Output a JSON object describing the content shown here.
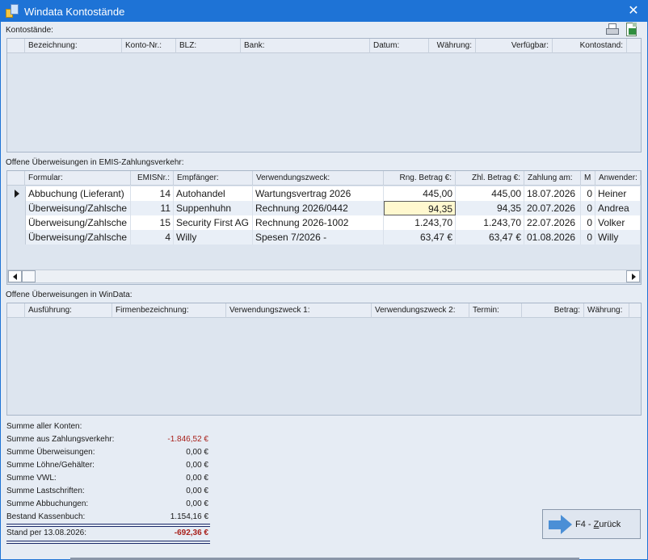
{
  "window": {
    "title": "Windata Kontostände",
    "close_label": "✕"
  },
  "toolbar": {
    "print_icon": "printer-icon",
    "export_icon": "excel-export-icon"
  },
  "accounts": {
    "label": "Kontostände:",
    "columns": [
      "Bezeichnung:",
      "Konto-Nr.:",
      "BLZ:",
      "Bank:",
      "Datum:",
      "Währung:",
      "Verfügbar:",
      "Kontostand:"
    ]
  },
  "emis": {
    "label": "Offene Überweisungen in EMIS-Zahlungsverkehr:",
    "columns": [
      "Formular:",
      "EMISNr.:",
      "Empfänger:",
      "Verwendungszweck:",
      "Rng. Betrag €:",
      "Zhl. Betrag €:",
      "Zahlung am:",
      "M",
      "Anwender:"
    ],
    "rows": [
      {
        "formular": "Abbuchung (Lieferant)",
        "nr": "14",
        "empfaenger": "Autohandel",
        "zweck": "Wartungsvertrag 2026",
        "rng": "445,00",
        "zhl": "445,00",
        "datum": "18.07.2026",
        "m": "0",
        "anwender": "Heiner"
      },
      {
        "formular": "Überweisung/Zahlsche",
        "nr": "11",
        "empfaenger": "Suppenhuhn",
        "zweck": "Rechnung 2026/0442",
        "rng": "94,35",
        "zhl": "94,35",
        "datum": "20.07.2026",
        "m": "0",
        "anwender": "Andrea"
      },
      {
        "formular": "Überweisung/Zahlsche",
        "nr": "15",
        "empfaenger": "Security First AG",
        "zweck": "Rechnung 2026-1002",
        "rng": "1.243,70",
        "zhl": "1.243,70",
        "datum": "22.07.2026",
        "m": "0",
        "anwender": "Volker"
      },
      {
        "formular": "Überweisung/Zahlsche",
        "nr": "4",
        "empfaenger": "Willy",
        "zweck": "Spesen 7/2026 -",
        "rng": "63,47 €",
        "zhl": "63,47 €",
        "datum": "01.08.2026",
        "m": "0",
        "anwender": "Willy"
      }
    ]
  },
  "windata": {
    "label": "Offene Überweisungen in WinData:",
    "columns": [
      "Ausführung:",
      "Firmenbezeichnung:",
      "Verwendungszweck 1:",
      "Verwendungszweck 2:",
      "Termin:",
      "Betrag:",
      "Währung:"
    ]
  },
  "summary": {
    "title": "Summe aller Konten:",
    "lines": [
      {
        "label": "Summe aus Zahlungsverkehr:",
        "value": "-1.846,52 €"
      },
      {
        "label": "Summe Überweisungen:",
        "value": "0,00 €"
      },
      {
        "label": "Summe Löhne/Gehälter:",
        "value": "0,00 €"
      },
      {
        "label": "Summe VWL:",
        "value": "0,00 €"
      },
      {
        "label": "Summe Lastschriften:",
        "value": "0,00 €"
      },
      {
        "label": "Summe Abbuchungen:",
        "value": "0,00 €"
      },
      {
        "label": "Bestand Kassenbuch:",
        "value": "1.154,16 €"
      }
    ],
    "total_label": "Stand per 13.08.2026:",
    "total_value": "-692,36 €"
  },
  "back_button": {
    "prefix": "F4 - ",
    "underlined": "Z",
    "rest": "urück"
  },
  "colors": {
    "titlebar": "#1e73d6",
    "negative": "#a8201a",
    "focus_cell": "#fff8cf"
  }
}
